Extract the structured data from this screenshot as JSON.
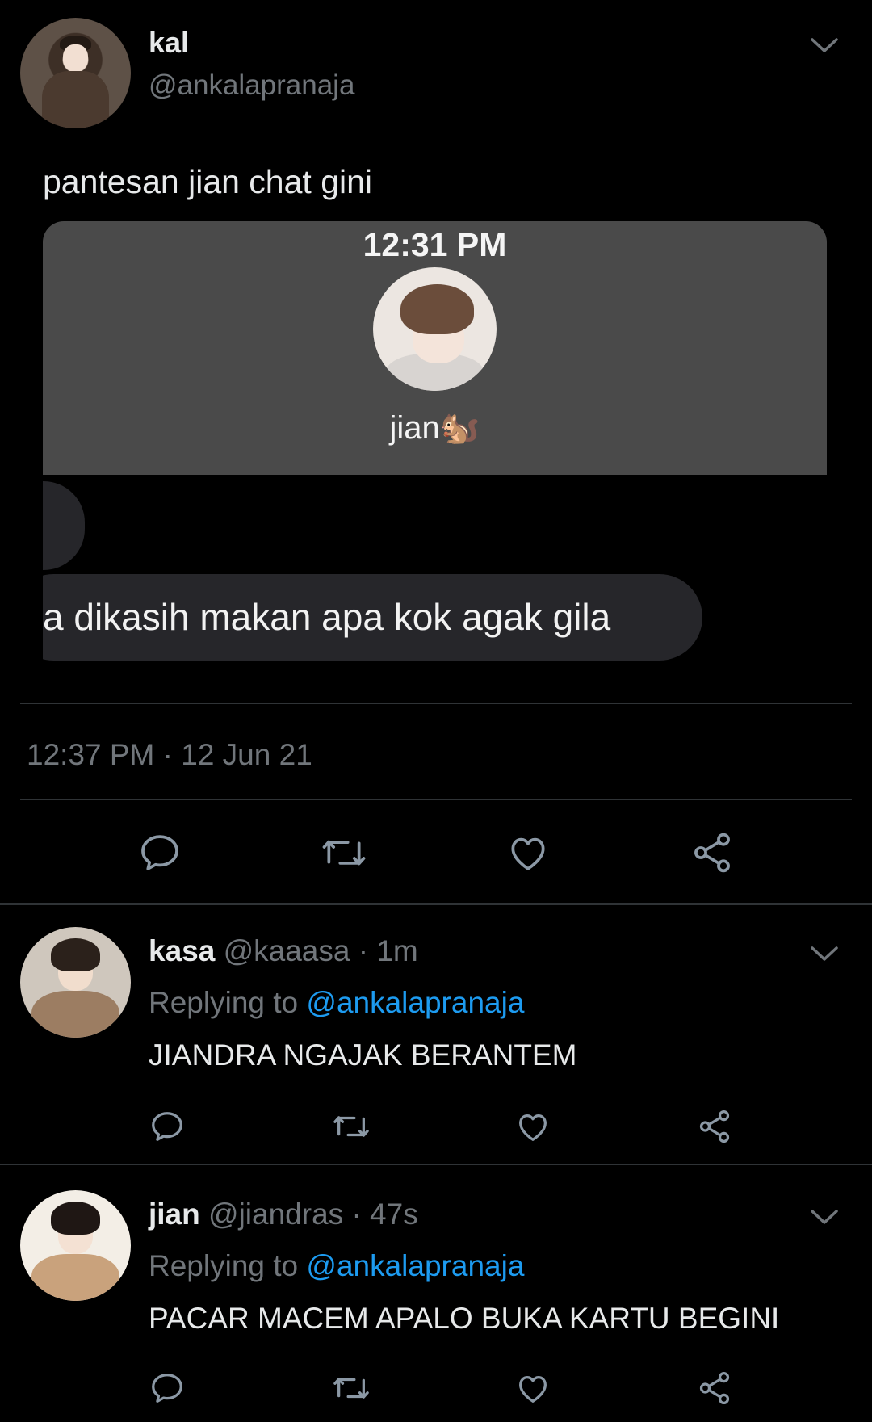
{
  "main_tweet": {
    "author_name": "kal",
    "author_handle": "@ankalapranaja",
    "text": "pantesan jian chat gini",
    "media": {
      "status_time": "12:31 PM",
      "contact_name": "jian",
      "contact_emoji": "🐿️",
      "message_text": "a dikasih makan apa kok agak gila"
    },
    "timestamp": "12:37 PM · 12 Jun 21"
  },
  "replies": [
    {
      "name": "kasa",
      "handle": "@kaaasa",
      "time": "· 1m",
      "replying_prefix": "Replying to",
      "replying_to": "@ankalapranaja",
      "text": "JIANDRA NGAJAK BERANTEM"
    },
    {
      "name": "jian",
      "handle": "@jiandras",
      "time": "· 47s",
      "replying_prefix": "Replying to",
      "replying_to": "@ankalapranaja",
      "text": "PACAR MACEM APALO BUKA KARTU BEGINI"
    }
  ],
  "icons": {
    "reply": "reply-icon",
    "retweet": "retweet-icon",
    "like": "heart-icon",
    "share": "share-icon",
    "menu": "chevron-down-icon"
  },
  "colors": {
    "background": "#000000",
    "text": "#e7e9ea",
    "muted": "#71767b",
    "link": "#1d9bf0",
    "divider": "#2f3336"
  }
}
